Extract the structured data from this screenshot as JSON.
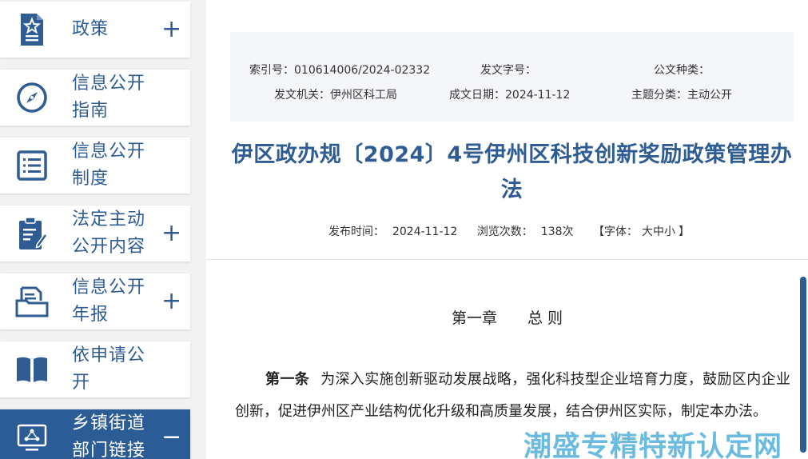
{
  "sidebar": {
    "items": [
      {
        "label": "政策",
        "toggle": "+",
        "icon": "policy-doc-star-icon",
        "active": false
      },
      {
        "label": "信息公开指南",
        "toggle": "",
        "icon": "compass-icon",
        "active": false
      },
      {
        "label": "信息公开制度",
        "toggle": "",
        "icon": "list-document-icon",
        "active": false
      },
      {
        "label": "法定主动公开内容",
        "toggle": "+",
        "icon": "clipboard-edit-icon",
        "active": false
      },
      {
        "label": "信息公开年报",
        "toggle": "+",
        "icon": "folder-document-icon",
        "active": false
      },
      {
        "label": "依申请公开",
        "toggle": "",
        "icon": "open-book-icon",
        "active": false
      },
      {
        "label": "乡镇街道部门链接",
        "toggle": "−",
        "icon": "network-monitor-icon",
        "active": true
      }
    ]
  },
  "meta": {
    "index_label": "索引号：",
    "index_value": "010614006/2024-02332",
    "docno_label": "发文字号：",
    "docno_value": "",
    "doctype_label": "公文种类：",
    "doctype_value": "",
    "issuer_label": "发文机关：",
    "issuer_value": "伊州区科工局",
    "date_label": "成文日期：",
    "date_value": "2024-11-12",
    "topic_label": "主题分类：",
    "topic_value": "主动公开"
  },
  "article": {
    "title": "伊区政办规〔2024〕4号伊州区科技创新奖励政策管理办法",
    "publish_label": "发布时间：",
    "publish_date": "2024-11-12",
    "views_label": "浏览次数：",
    "views_value": "138次",
    "font_open": "【字体：",
    "font_large": "大",
    "font_medium": "中",
    "font_small": "小",
    "font_close": "】",
    "chapter": "第一章　　总 则",
    "clause_label": "第一条",
    "clause_text": "为深入实施创新驱动发展战略，强化科技型企业培育力度，鼓励区内企业创新，促进伊州区产业结构优化升级和高质量发展，结合伊州区实际，制定本办法。"
  },
  "watermark": "潮盛专精特新认定网",
  "colors": {
    "accent": "#2f5d93",
    "active_bg": "#2b5c96",
    "watermark": "#5ab4dc"
  }
}
